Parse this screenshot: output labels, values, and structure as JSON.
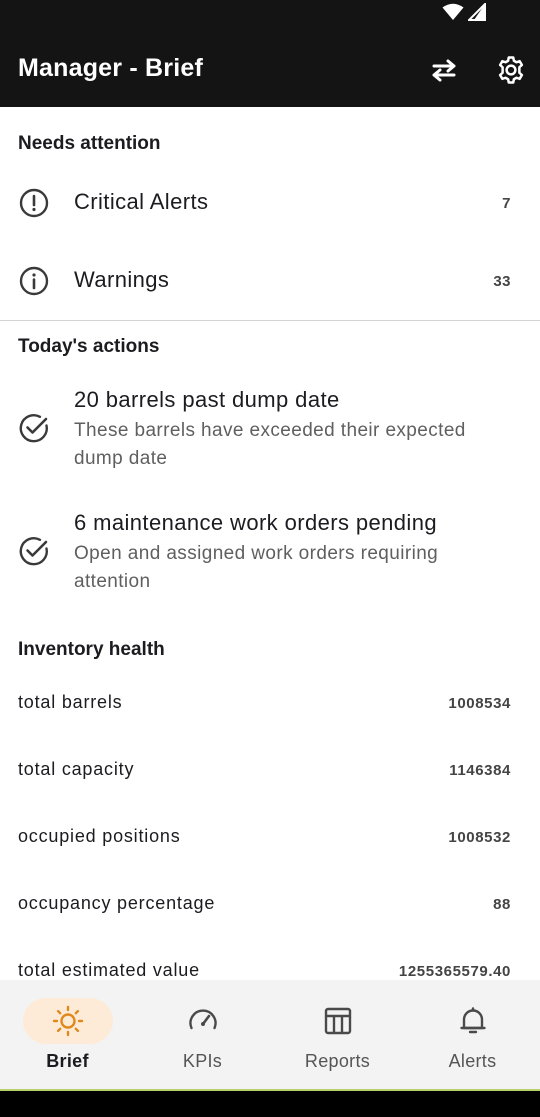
{
  "app": {
    "title": "Manager - Brief"
  },
  "needs_attention": {
    "heading": "Needs attention",
    "items": [
      {
        "label": "Critical Alerts",
        "count": "7",
        "icon": "alert-circle-icon"
      },
      {
        "label": "Warnings",
        "count": "33",
        "icon": "info-circle-icon"
      }
    ]
  },
  "todays_actions": {
    "heading": "Today's actions",
    "items": [
      {
        "title": "20 barrels past dump date",
        "subtitle": "These barrels have exceeded their expected dump date",
        "icon": "check-circle-icon"
      },
      {
        "title": "6 maintenance work orders pending",
        "subtitle": "Open and assigned work orders requiring attention",
        "icon": "check-circle-icon"
      }
    ]
  },
  "inventory_health": {
    "heading": "Inventory health",
    "rows": [
      {
        "label": "total barrels",
        "value": "1008534"
      },
      {
        "label": "total capacity",
        "value": "1146384"
      },
      {
        "label": "occupied positions",
        "value": "1008532"
      },
      {
        "label": "occupancy percentage",
        "value": "88"
      },
      {
        "label": "total estimated value",
        "value": "1255365579.40"
      }
    ]
  },
  "bottom_nav": {
    "items": [
      {
        "label": "Brief",
        "icon": "sun-icon",
        "active": true
      },
      {
        "label": "KPIs",
        "icon": "speedometer-icon",
        "active": false
      },
      {
        "label": "Reports",
        "icon": "table-icon",
        "active": false
      },
      {
        "label": "Alerts",
        "icon": "bell-icon",
        "active": false
      }
    ]
  },
  "colors": {
    "appbar": "#141414",
    "active_pill": "#fdebd7",
    "active_icon": "#e08a1e",
    "nav_background": "#f3f3f3",
    "accent_line": "#b8d26b"
  }
}
